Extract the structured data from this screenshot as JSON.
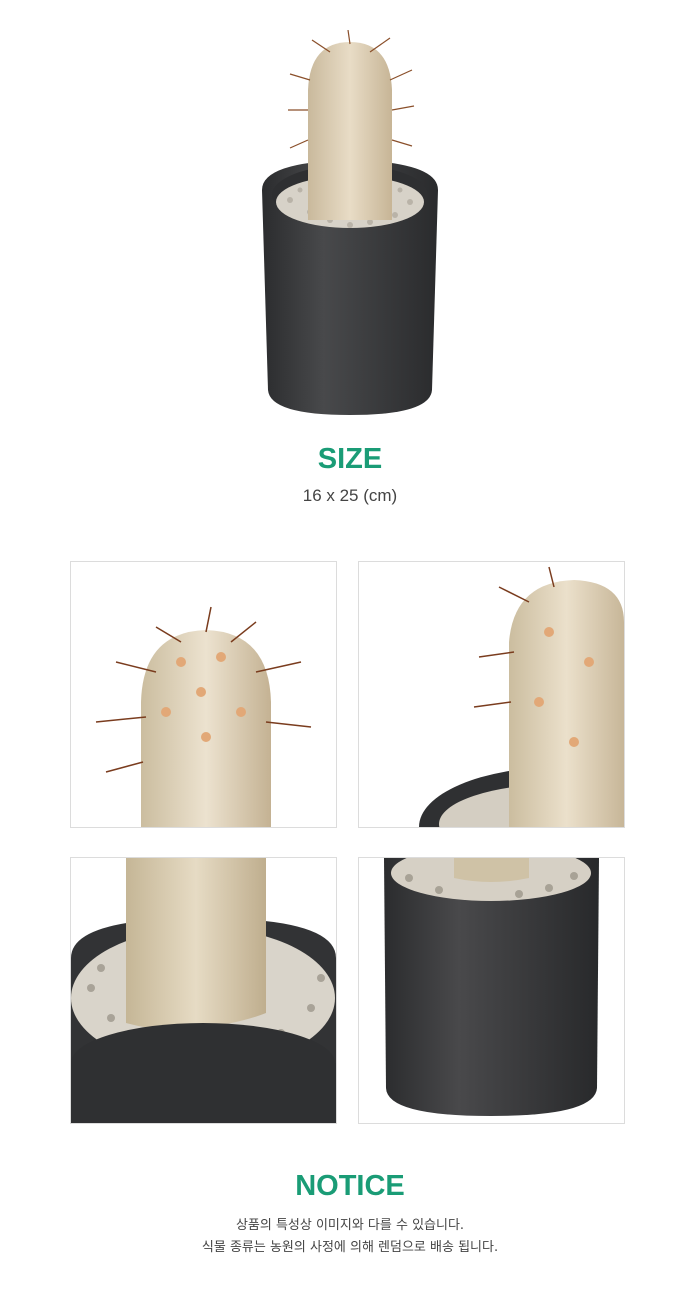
{
  "size": {
    "title": "SIZE",
    "value": "16 x 25 (cm)"
  },
  "notice": {
    "title": "NOTICE",
    "lines": [
      "상품의 특성상 이미지와 다를 수 있습니다.",
      "식물 종류는 농원의 사정에 의해 렌덤으로 배송 됩니다."
    ]
  },
  "colors": {
    "accent": "#1a9c76",
    "pot": "#3a3b3d",
    "cactus": "#d9c9ae"
  }
}
